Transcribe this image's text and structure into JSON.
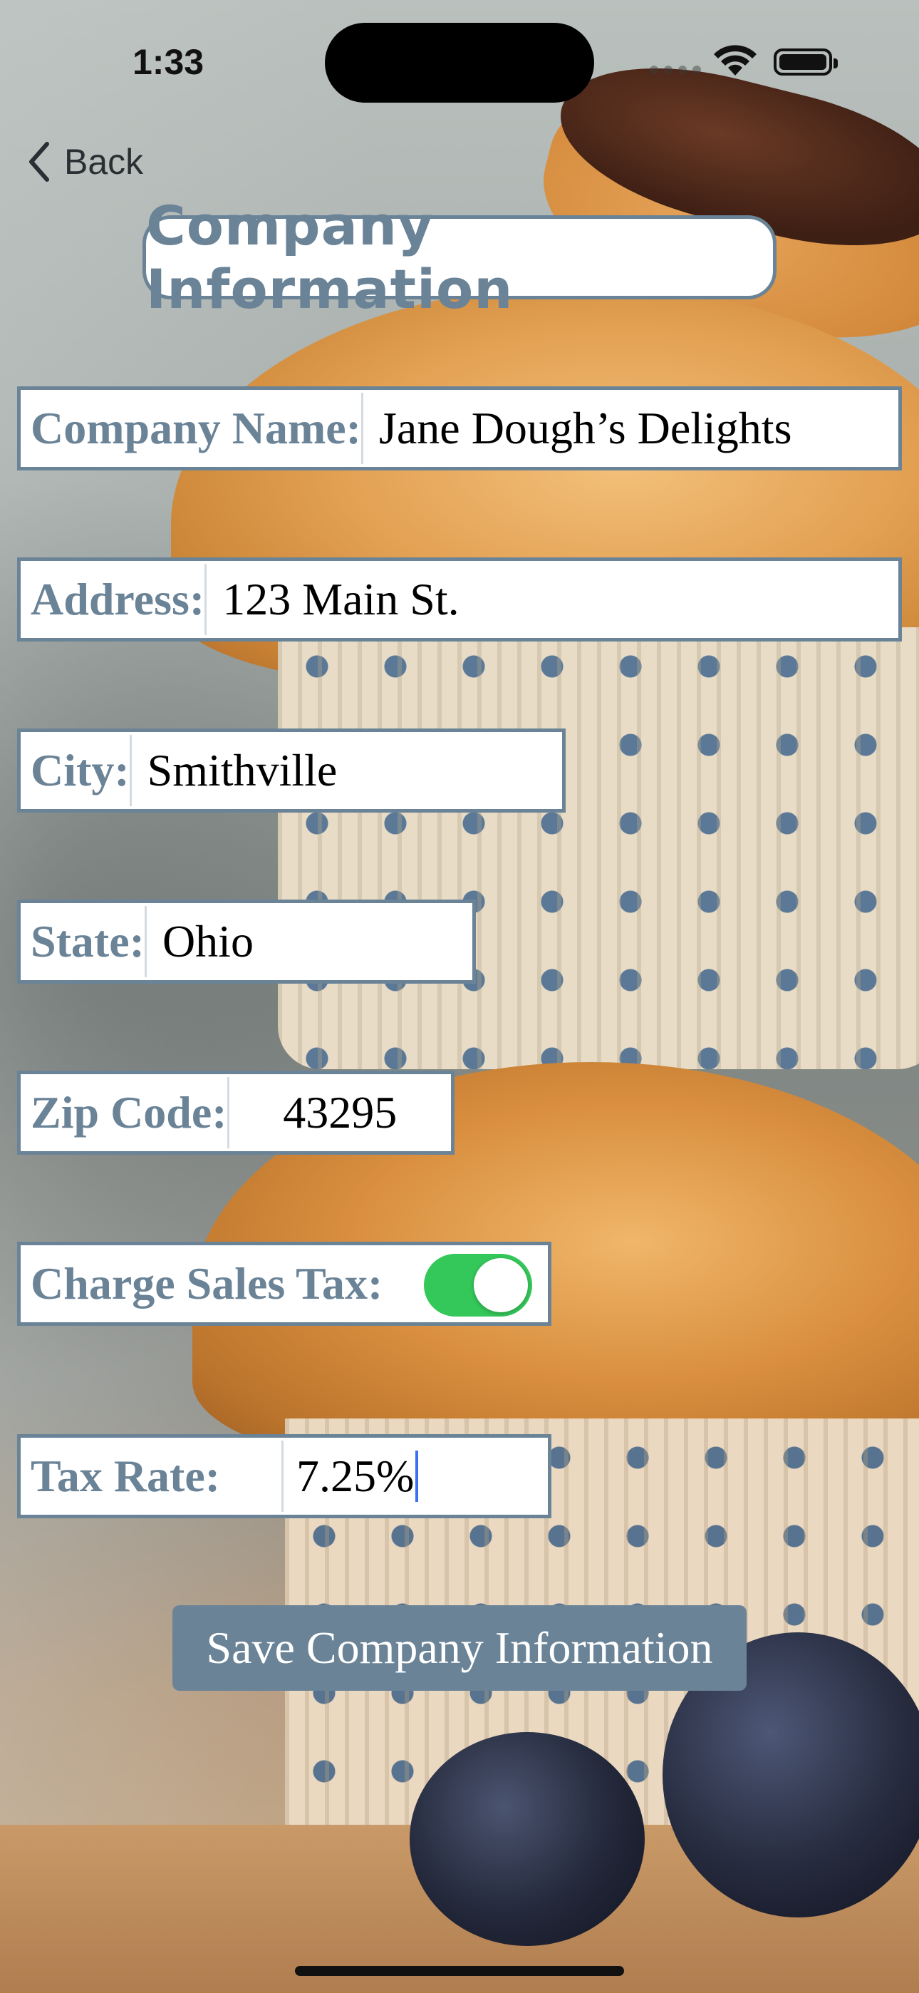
{
  "status_bar": {
    "time": "1:33"
  },
  "nav": {
    "back_label": "Back"
  },
  "page_title": "Company Information",
  "form": {
    "company_name": {
      "label": "Company Name:",
      "value": "Jane Dough’s Delights"
    },
    "address": {
      "label": "Address:",
      "value": "123 Main St."
    },
    "city": {
      "label": "City:",
      "value": "Smithville"
    },
    "state": {
      "label": "State:",
      "value": "Ohio"
    },
    "zip": {
      "label": "Zip Code:",
      "value": "43295"
    },
    "sales_tax": {
      "label": "Charge Sales Tax:",
      "enabled": true
    },
    "tax_rate": {
      "label": "Tax Rate:",
      "value": "7.25%"
    }
  },
  "save_button_label": "Save Company Information",
  "colors": {
    "accent": "#6a8397",
    "toggle_on": "#34c759",
    "caret": "#3b6ff5"
  },
  "icons": {
    "back": "chevron-left-icon",
    "wifi": "wifi-icon",
    "battery": "battery-icon",
    "signal": "cellular-signal-icon"
  }
}
